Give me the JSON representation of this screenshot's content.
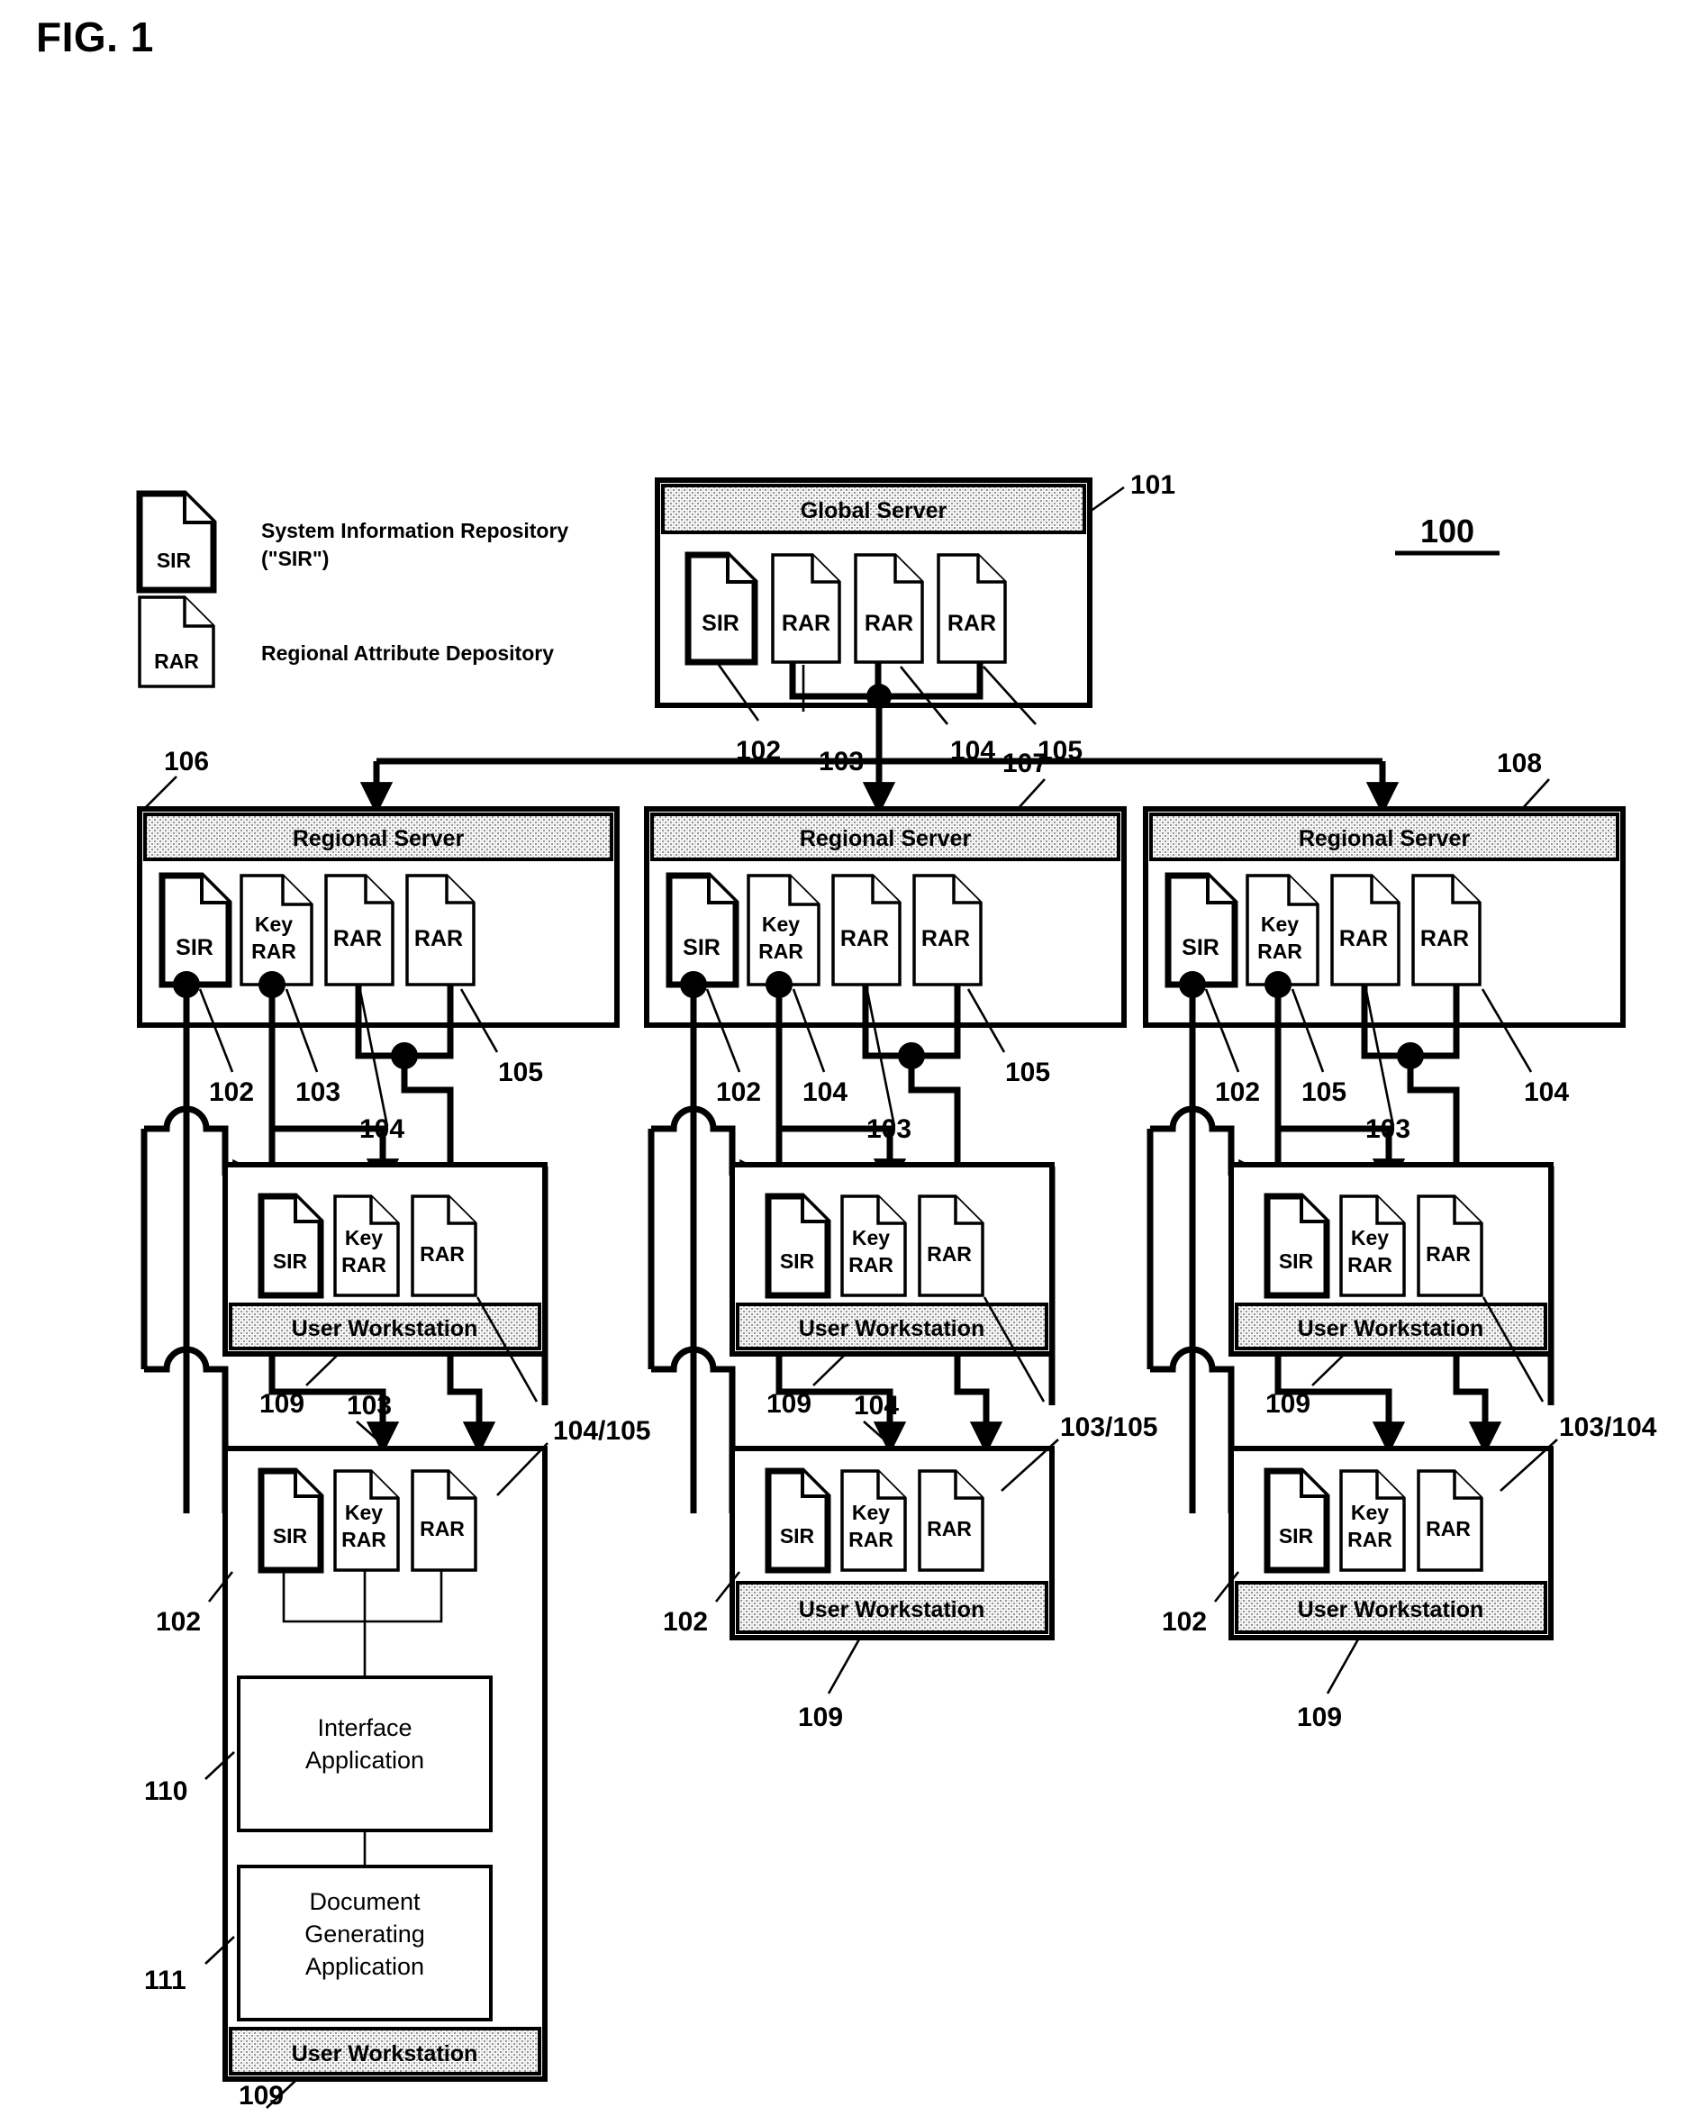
{
  "figure": {
    "label": "FIG. 1",
    "system_ref": "100"
  },
  "legend": {
    "items": [
      {
        "icon": "sir-document-icon",
        "icon_label": "SIR",
        "text_line1": "System Information Repository",
        "text_line2": "(\"SIR\")"
      },
      {
        "icon": "rar-document-icon",
        "icon_label": "RAR",
        "text_line1": "Regional Attribute Depository",
        "text_line2": ""
      }
    ]
  },
  "global_server": {
    "title": "Global Server",
    "ref": "101",
    "documents": [
      {
        "label": "SIR",
        "ref": "102",
        "style": "thick"
      },
      {
        "label": "RAR",
        "ref": "103",
        "style": "thin"
      },
      {
        "label": "RAR",
        "ref": "104",
        "style": "thin"
      },
      {
        "label": "RAR",
        "ref": "105",
        "style": "thin"
      }
    ]
  },
  "regional_servers": [
    {
      "title": "Regional Server",
      "ref": "106",
      "documents": [
        {
          "label": "SIR",
          "ref": "102",
          "style": "thick"
        },
        {
          "label": "Key RAR",
          "ref": "103",
          "style": "thin"
        },
        {
          "label": "RAR",
          "ref": "104",
          "style": "thin"
        },
        {
          "label": "RAR",
          "ref": "105",
          "style": "thin"
        }
      ]
    },
    {
      "title": "Regional Server",
      "ref": "107",
      "documents": [
        {
          "label": "SIR",
          "ref": "102",
          "style": "thick"
        },
        {
          "label": "Key RAR",
          "ref": "104",
          "style": "thin"
        },
        {
          "label": "RAR",
          "ref": "103",
          "style": "thin"
        },
        {
          "label": "RAR",
          "ref": "105",
          "style": "thin"
        }
      ]
    },
    {
      "title": "Regional Server",
      "ref": "108",
      "documents": [
        {
          "label": "SIR",
          "ref": "102",
          "style": "thick"
        },
        {
          "label": "Key RAR",
          "ref": "105",
          "style": "thin"
        },
        {
          "label": "RAR",
          "ref": "103",
          "style": "thin"
        },
        {
          "label": "RAR",
          "ref": "104",
          "style": "thin"
        }
      ]
    }
  ],
  "workstations": [
    {
      "column": 1,
      "row": "upper",
      "title": "User Workstation",
      "ref": "109",
      "documents": [
        {
          "label": "SIR",
          "ref": "102",
          "style": "thick"
        },
        {
          "label": "Key RAR",
          "ref": "103",
          "style": "thin"
        },
        {
          "label": "RAR",
          "ref": "104",
          "style": "thin"
        }
      ]
    },
    {
      "column": 1,
      "row": "lower",
      "title": "User Workstation",
      "ref": "109",
      "documents": [
        {
          "label": "SIR",
          "ref": "102",
          "style": "thick"
        },
        {
          "label": "Key RAR",
          "ref": "103",
          "style": "thin"
        },
        {
          "label": "RAR",
          "ref": "104/105",
          "style": "thin"
        }
      ],
      "applications": [
        {
          "name": "Interface Application",
          "line1": "Interface",
          "line2": "Application",
          "line3": "",
          "ref": "110"
        },
        {
          "name": "Document Generating Application",
          "line1": "Document",
          "line2": "Generating",
          "line3": "Application",
          "ref": "111"
        }
      ]
    },
    {
      "column": 2,
      "row": "upper",
      "title": "User Workstation",
      "ref": "109",
      "documents": [
        {
          "label": "SIR",
          "ref": "102",
          "style": "thick"
        },
        {
          "label": "Key RAR",
          "ref": "104",
          "style": "thin"
        },
        {
          "label": "RAR",
          "ref": "103",
          "style": "thin"
        }
      ]
    },
    {
      "column": 2,
      "row": "lower",
      "title": "User Workstation",
      "ref": "109",
      "documents": [
        {
          "label": "SIR",
          "ref": "102",
          "style": "thick"
        },
        {
          "label": "Key RAR",
          "ref": "104",
          "style": "thin"
        },
        {
          "label": "RAR",
          "ref": "103/105",
          "style": "thin"
        }
      ]
    },
    {
      "column": 3,
      "row": "upper",
      "title": "User Workstation",
      "ref": "109",
      "documents": [
        {
          "label": "SIR",
          "ref": "102",
          "style": "thick"
        },
        {
          "label": "Key RAR",
          "ref": "105",
          "style": "thin"
        },
        {
          "label": "RAR",
          "ref": "103",
          "style": "thin"
        }
      ]
    },
    {
      "column": 3,
      "row": "lower",
      "title": "User Workstation",
      "ref": "109",
      "documents": [
        {
          "label": "SIR",
          "ref": "102",
          "style": "thick"
        },
        {
          "label": "Key RAR",
          "ref": "105",
          "style": "thin"
        },
        {
          "label": "RAR",
          "ref": "103/104",
          "style": "thin"
        }
      ]
    }
  ],
  "reference_numerals": {
    "col1_regional_out": [
      "102",
      "103",
      "104",
      "105"
    ],
    "col2_regional_out": [
      "102",
      "104",
      "103",
      "105"
    ],
    "col3_regional_out": [
      "102",
      "105",
      "103",
      "104"
    ],
    "col1_ws_upper_out": [
      "109",
      "103"
    ],
    "col2_ws_upper_out": [
      "109",
      "104"
    ],
    "col3_ws_upper_out": [
      "109",
      "103"
    ],
    "col1_ws_lower_out": [
      "102",
      "104/105",
      "109"
    ],
    "col2_ws_lower_out": [
      "102",
      "103/105",
      "109"
    ],
    "col3_ws_lower_out": [
      "102",
      "103/104",
      "109"
    ]
  }
}
